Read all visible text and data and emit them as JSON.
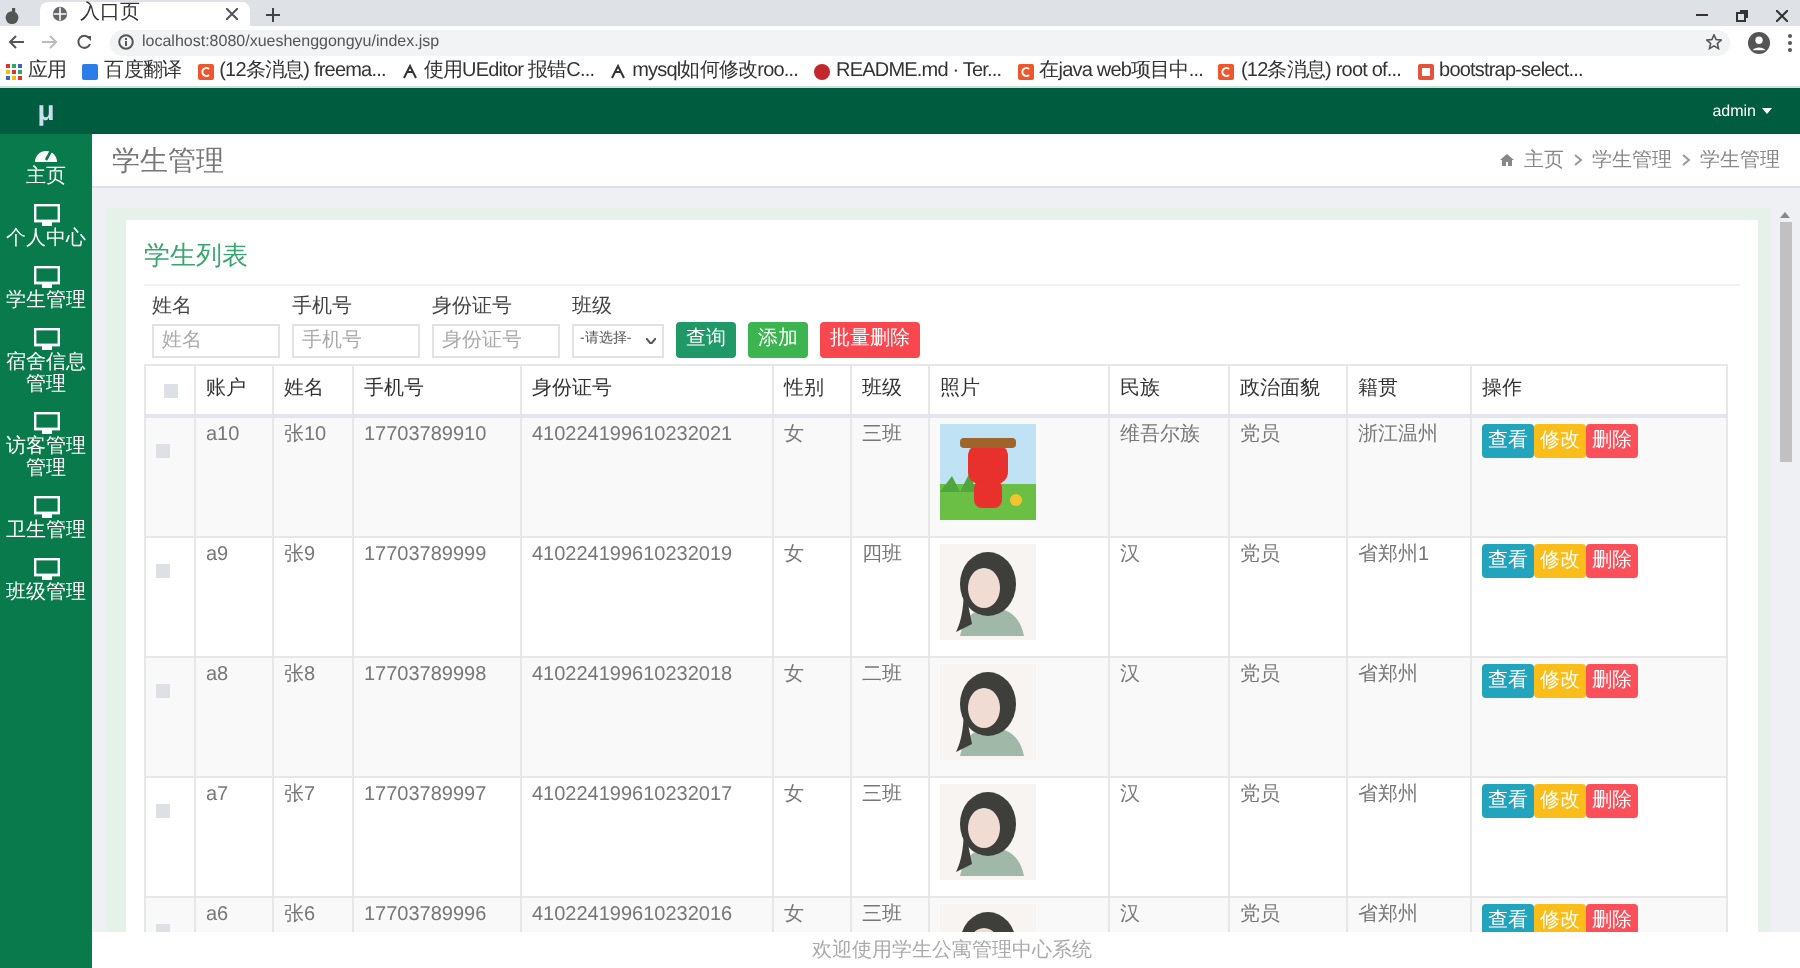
{
  "browser": {
    "tab_title": "入口页",
    "url": "localhost:8080/xueshenggongyu/index.jsp",
    "bookmarks": [
      {
        "label": "应用",
        "kind": "apps"
      },
      {
        "label": "百度翻译",
        "kind": "blue"
      },
      {
        "label": "(12条消息) freema...",
        "kind": "red"
      },
      {
        "label": "使用UEditor 报错C...",
        "kind": "cat"
      },
      {
        "label": "mysql如何修改roo...",
        "kind": "cat"
      },
      {
        "label": "README.md · Ter...",
        "kind": "round"
      },
      {
        "label": "在java web项目中...",
        "kind": "red"
      },
      {
        "label": "(12条消息) root of...",
        "kind": "red"
      },
      {
        "label": "bootstrap-select...",
        "kind": "square"
      }
    ]
  },
  "app": {
    "logo": "μ",
    "user": "admin",
    "sidebar": [
      {
        "label": "主页",
        "kind": "gauge"
      },
      {
        "label": "个人中心",
        "kind": "monitor"
      },
      {
        "label": "学生管理",
        "kind": "monitor"
      },
      {
        "label": "宿舍信息管理",
        "kind": "monitor"
      },
      {
        "label": "访客管理管理",
        "kind": "monitor"
      },
      {
        "label": "卫生管理",
        "kind": "monitor"
      },
      {
        "label": "班级管理",
        "kind": "monitor"
      }
    ],
    "page_title": "学生管理",
    "breadcrumb": [
      "主页",
      "学生管理",
      "学生管理"
    ],
    "card_title": "学生列表",
    "filters": [
      {
        "label": "姓名",
        "placeholder": "姓名",
        "kind": "text"
      },
      {
        "label": "手机号",
        "placeholder": "手机号",
        "kind": "text"
      },
      {
        "label": "身份证号",
        "placeholder": "身份证号",
        "kind": "text"
      },
      {
        "label": "班级",
        "value": "-请选择-",
        "kind": "select"
      }
    ],
    "actions": [
      {
        "label": "查询",
        "kind": "search"
      },
      {
        "label": "添加",
        "kind": "add"
      },
      {
        "label": "批量删除",
        "kind": "delete"
      }
    ],
    "table": {
      "columns": [
        "账户",
        "姓名",
        "手机号",
        "身份证号",
        "性别",
        "班级",
        "照片",
        "民族",
        "政治面貌",
        "籍贯",
        "操作"
      ],
      "select_all_checked": false,
      "rows": [
        {
          "checked": false,
          "cells": [
            "a10",
            "张10",
            "17703789910",
            "410224199610232021",
            "女",
            "三班"
          ],
          "photo": {
            "kind": "picture"
          },
          "cells_after": [
            "维吾尔族",
            "党员",
            "浙江温州"
          ],
          "buttons": [
            "查看",
            "修改",
            "删除"
          ]
        },
        {
          "checked": false,
          "cells": [
            "a9",
            "张9",
            "17703789999",
            "410224199610232019",
            "女",
            "四班"
          ],
          "photo": {
            "kind": "picture"
          },
          "cells_after": [
            "汉",
            "党员",
            "省郑州1"
          ],
          "buttons": [
            "查看",
            "修改",
            "删除"
          ]
        },
        {
          "checked": false,
          "cells": [
            "a8",
            "张8",
            "17703789998",
            "410224199610232018",
            "女",
            "二班"
          ],
          "photo": {
            "kind": "picture"
          },
          "cells_after": [
            "汉",
            "党员",
            "省郑州"
          ],
          "buttons": [
            "查看",
            "修改",
            "删除"
          ]
        },
        {
          "checked": false,
          "cells": [
            "a7",
            "张7",
            "17703789997",
            "410224199610232017",
            "女",
            "三班"
          ],
          "photo": {
            "kind": "picture"
          },
          "cells_after": [
            "汉",
            "党员",
            "省郑州"
          ],
          "buttons": [
            "查看",
            "修改",
            "删除"
          ]
        },
        {
          "checked": false,
          "cells": [
            "a6",
            "张6",
            "17703789996",
            "410224199610232016",
            "女",
            "三班"
          ],
          "photo": {
            "kind": "picture"
          },
          "cells_after": [
            "汉",
            "党员",
            "省郑州"
          ],
          "buttons": [
            "查看",
            "修改",
            "删除"
          ]
        }
      ]
    },
    "footer": "欢迎使用学生公寓管理中心系统"
  }
}
